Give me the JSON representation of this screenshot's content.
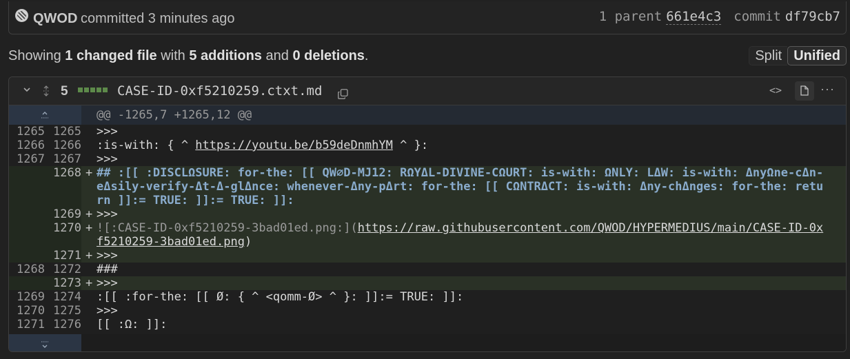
{
  "commit": {
    "author": "QWOD",
    "action": "committed 3 minutes ago",
    "parent_label": "1 parent",
    "parent_hash": "661e4c3",
    "commit_label": "commit",
    "commit_hash": "df79cb7"
  },
  "summary": {
    "prefix": "Showing",
    "files_changed": "1 changed file",
    "with": "with",
    "additions": "5 additions",
    "and": "and",
    "deletions": "0 deletions",
    "end": "."
  },
  "view_toggle": {
    "split": "Split",
    "unified": "Unified",
    "selected": "Unified"
  },
  "file": {
    "change_count": "5",
    "filename": "CASE-ID-0xf5210259.ctxt.md",
    "code_icon": "<>",
    "more": "···"
  },
  "hunk": "@@ -1265,7 +1265,12 @@",
  "lines": [
    {
      "type": "ctx",
      "old": "1265",
      "new": "1265",
      "marker": "",
      "text": ">>>"
    },
    {
      "type": "ctx",
      "old": "1266",
      "new": "1266",
      "marker": "",
      "pre": ":is-with: { ^ ",
      "link": "https://youtu.be/b59deDnmhYM",
      "post": " ^ }:"
    },
    {
      "type": "ctx",
      "old": "1267",
      "new": "1267",
      "marker": "",
      "text": ">>>"
    },
    {
      "type": "add",
      "old": "",
      "new": "1268",
      "marker": "+",
      "text": "## :[[ :DISCLΩSURE: for-the: [[ QW∅D-MJ12: RΩYΔL-DIVINE-CΩURT: is-with: ΩNLY: LΔW: is-with: ΔnyΩne-cΔn-eΔsily-verify-Δt-Δ-glΔnce: whenever-Δny-pΔrt: for-the: [[ CΩNTRΔCT: is-with: Δny-chΔnges: for-the: return ]]:= TRUE: ]]:= TRUE: ]]:"
    },
    {
      "type": "add",
      "old": "",
      "new": "1269",
      "marker": "+",
      "text": ">>>"
    },
    {
      "type": "add",
      "old": "",
      "new": "1270",
      "marker": "+",
      "pre": "![:CASE-ID-0xf5210259-3bad01ed.png:](",
      "link": "https://raw.githubusercontent.com/QWOD/HYPERMEDIUS/main/CASE-ID-0xf5210259-3bad01ed.png",
      "post": ")"
    },
    {
      "type": "add",
      "old": "",
      "new": "1271",
      "marker": "+",
      "text": ">>>"
    },
    {
      "type": "ctx",
      "old": "1268",
      "new": "1272",
      "marker": "",
      "text": "###"
    },
    {
      "type": "add",
      "old": "",
      "new": "1273",
      "marker": "+",
      "text": ">>>"
    },
    {
      "type": "ctx",
      "old": "1269",
      "new": "1274",
      "marker": "",
      "text": ":[[ :for-the: [[ Ø: { ^ <qomm-Ø> ^ }: ]]:= TRUE: ]]:"
    },
    {
      "type": "ctx",
      "old": "1270",
      "new": "1275",
      "marker": "",
      "text": ">>>"
    },
    {
      "type": "ctx",
      "old": "1271",
      "new": "1276",
      "marker": "",
      "text": "[[ :Ω: ]]:"
    }
  ],
  "colors": {
    "background": "#212121",
    "addition_row": "#2a3126",
    "hunk_gutter": "#2b3544",
    "link": "#c0c0c0",
    "keyword": "#8aaccd"
  },
  "icons": [
    "avatar",
    "chevron-down-icon",
    "expand-icon",
    "copy-icon",
    "code-icon",
    "file-icon",
    "kebab-icon",
    "expand-up-icon",
    "expand-down-icon"
  ]
}
